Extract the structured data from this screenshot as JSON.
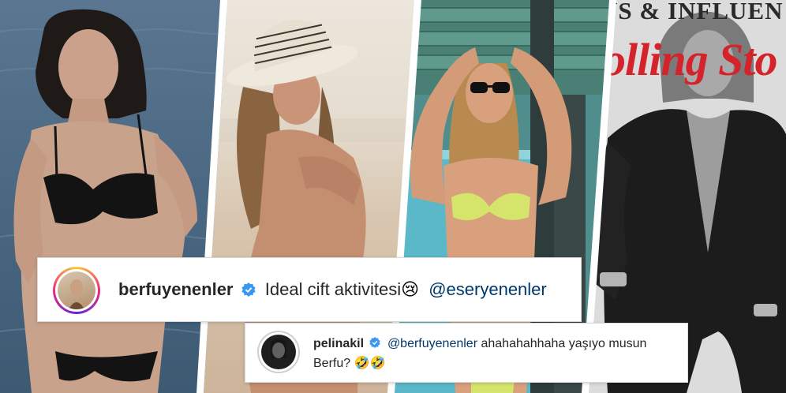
{
  "colors": {
    "instagram_verified": "#3897f0",
    "mention": "#00376b",
    "text": "#262626",
    "magazine_red": "#d4232b"
  },
  "magazine": {
    "headline": "NS & INFLUEN",
    "masthead": "olling Sto"
  },
  "comment1": {
    "username": "berfuyenenler",
    "text": "Ideal cift aktivitesi",
    "emoji": "😢",
    "mention": "@eseryenenler",
    "icon": "verified-badge-icon"
  },
  "comment2": {
    "username": "pelinakil",
    "mention": "@berfuyenenler",
    "text_line1": "ahahahahhaha yaşıyo musun",
    "text_line2": "Berfu?",
    "emoji": "🤣🤣",
    "icon": "verified-badge-icon"
  }
}
